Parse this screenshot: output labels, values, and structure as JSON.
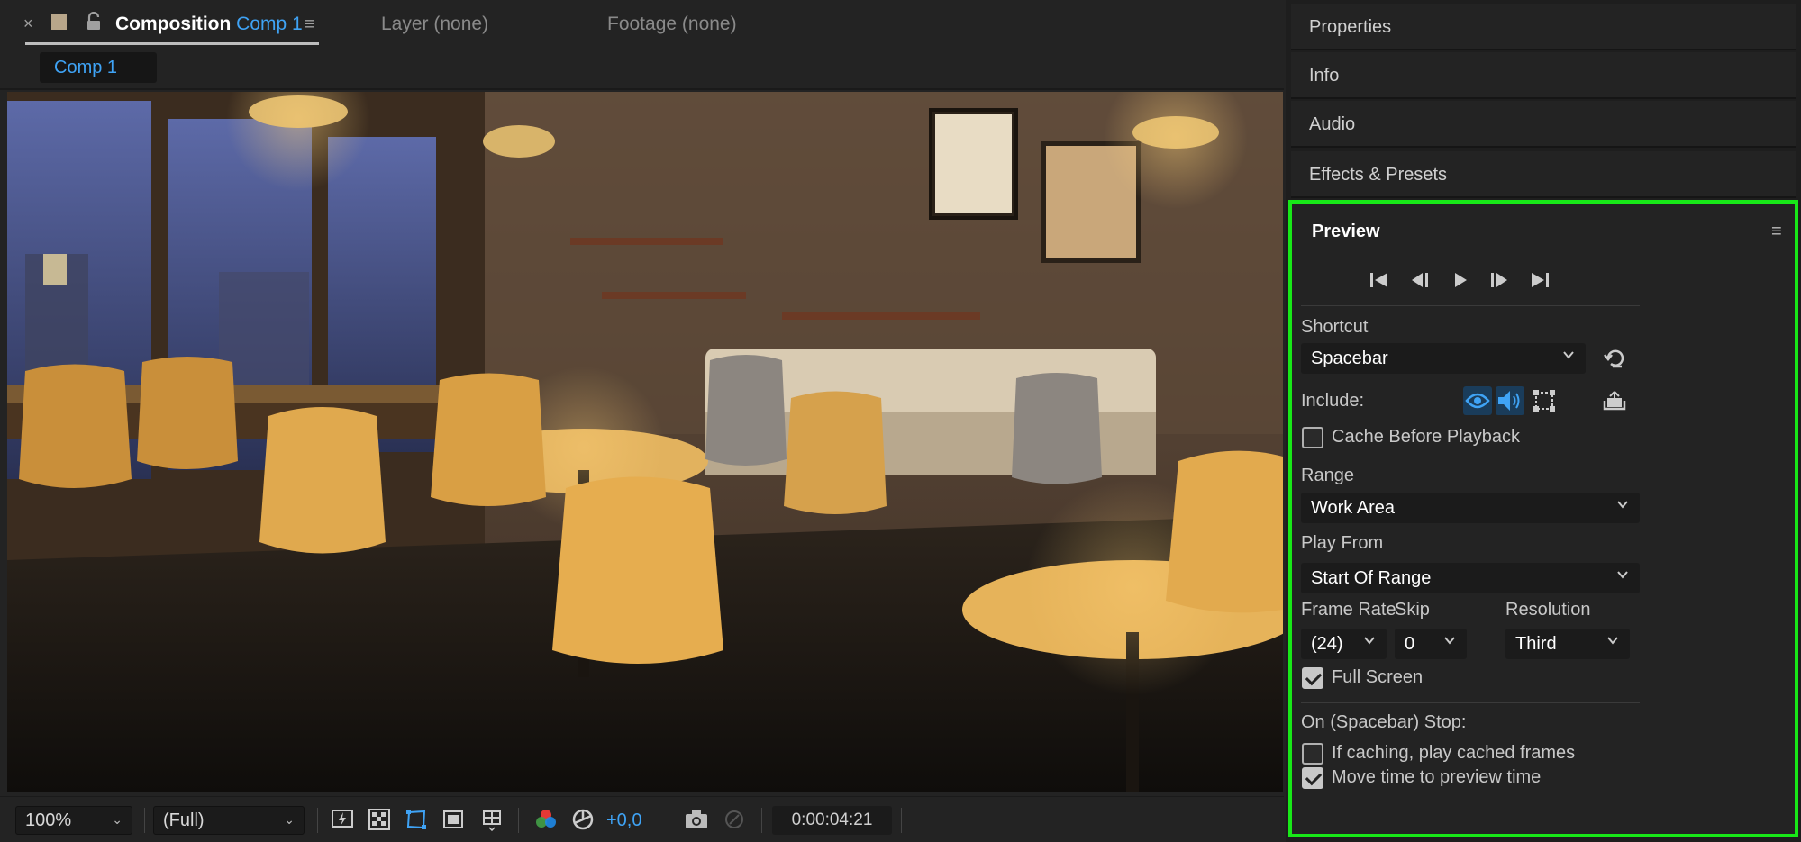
{
  "comp_tabs": {
    "close_icon": "×",
    "composition_label": "Composition",
    "composition_name": "Comp 1",
    "menu_icon": "≡",
    "layer_tab": "Layer (none)",
    "footage_tab": "Footage (none)",
    "comp_chip": "Comp 1"
  },
  "viewer": {
    "scene": "cafe-interior-night"
  },
  "bottom_bar": {
    "zoom": "100%",
    "resolution": "(Full)",
    "exposure": "+0,0",
    "timecode": "0:00:04:21"
  },
  "right_panel": {
    "headers": [
      "Properties",
      "Info",
      "Audio",
      "Effects & Presets"
    ]
  },
  "preview": {
    "title": "Preview",
    "menu_icon": "≡",
    "shortcut_label": "Shortcut",
    "shortcut_value": "Spacebar",
    "include_label": "Include:",
    "cache_before_playback": "Cache Before Playback",
    "range_label": "Range",
    "range_value": "Work Area",
    "play_from_label": "Play From",
    "play_from_value": "Start Of Range",
    "frame_rate_label": "Frame Rate",
    "frame_rate_value": "(24)",
    "skip_label": "Skip",
    "skip_value": "0",
    "resolution_label": "Resolution",
    "resolution_value": "Third",
    "full_screen": "Full Screen",
    "stop_label": "On (Spacebar) Stop:",
    "if_caching": "If caching, play cached frames",
    "move_time": "Move time to preview time",
    "checks": {
      "cache_before_playback": false,
      "full_screen": true,
      "if_caching": false,
      "move_time": true
    }
  },
  "colors": {
    "accent_blue": "#3fa3f5",
    "highlight_green": "#18e818",
    "panel_bg": "#232323"
  }
}
